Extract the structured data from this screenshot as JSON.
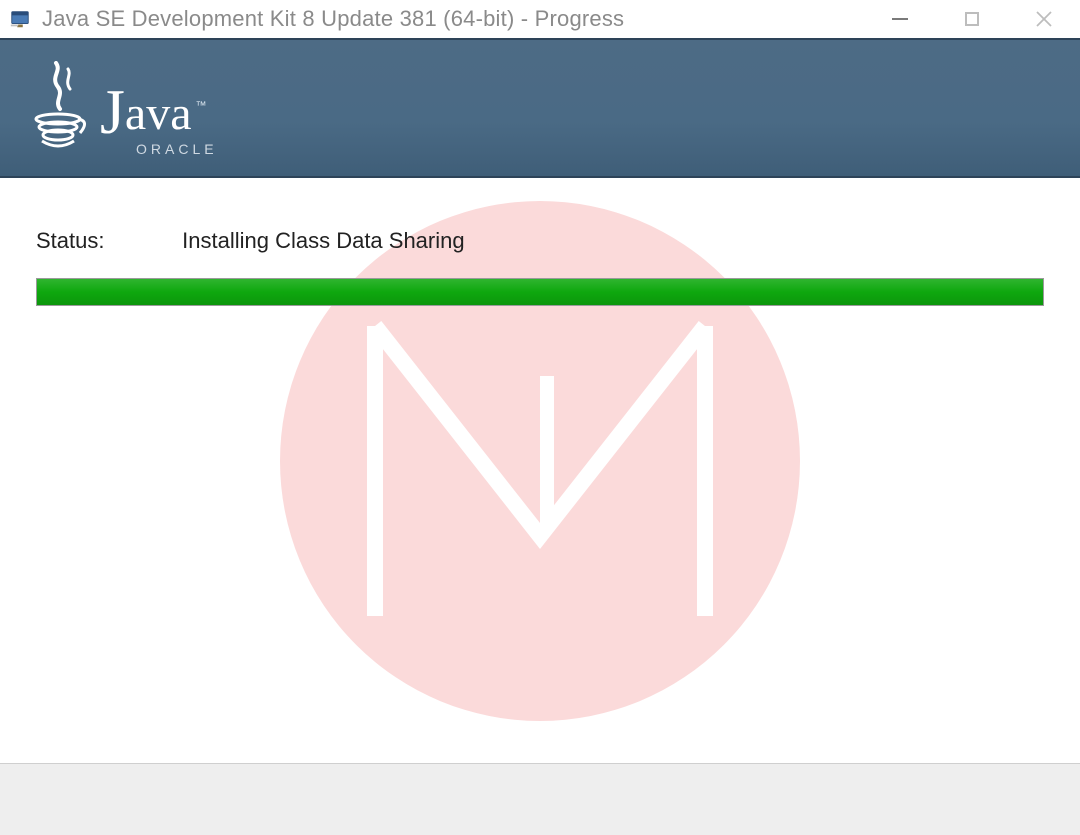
{
  "window": {
    "title": "Java SE Development Kit 8 Update 381 (64-bit) - Progress"
  },
  "branding": {
    "product": "Java",
    "vendor": "ORACLE",
    "tm": "™"
  },
  "status": {
    "label": "Status:",
    "message": "Installing Class Data Sharing",
    "progress_percent": 100
  },
  "colors": {
    "banner_bg": "#4a6a85",
    "progress_fill": "#0ea80e",
    "watermark": "#fbdada"
  }
}
